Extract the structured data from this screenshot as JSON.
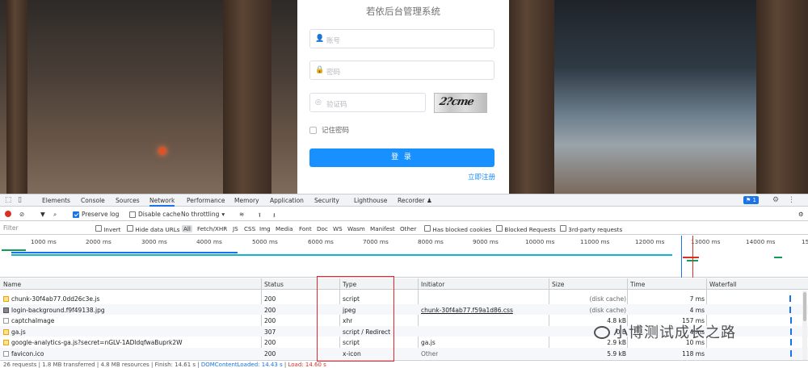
{
  "login": {
    "title": "若依后台管理系统",
    "username_placeholder": "账号",
    "password_placeholder": "密码",
    "code_placeholder": "验证码",
    "captcha_text": "2?cme",
    "remember": "记住密码",
    "submit": "登 录",
    "register": "立即注册"
  },
  "devtools": {
    "tabs": [
      "Elements",
      "Console",
      "Sources",
      "Network",
      "Performance",
      "Memory",
      "Application",
      "Security",
      "Lighthouse",
      "Recorder ♟"
    ],
    "active_tab": "Network",
    "issues_count": "1",
    "toolbar": {
      "preserve_log": "Preserve log",
      "disable_cache": "Disable cache",
      "throttling": "No throttling"
    },
    "filter": {
      "placeholder": "Filter",
      "invert": "Invert",
      "hide_data_urls": "Hide data URLs",
      "types": [
        "All",
        "Fetch/XHR",
        "JS",
        "CSS",
        "Img",
        "Media",
        "Font",
        "Doc",
        "WS",
        "Wasm",
        "Manifest",
        "Other"
      ],
      "blocked_cookies": "Has blocked cookies",
      "blocked_requests": "Blocked Requests",
      "third_party": "3rd-party requests"
    },
    "timeline_ticks": [
      "1000 ms",
      "2000 ms",
      "3000 ms",
      "4000 ms",
      "5000 ms",
      "6000 ms",
      "7000 ms",
      "8000 ms",
      "9000 ms",
      "10000 ms",
      "11000 ms",
      "12000 ms",
      "13000 ms",
      "14000 ms",
      "15"
    ],
    "columns": {
      "name": "Name",
      "status": "Status",
      "type": "Type",
      "initiator": "Initiator",
      "size": "Size",
      "time": "Time",
      "waterfall": "Waterfall"
    },
    "rows": [
      {
        "name": "chunk-30f4ab77.0dd26c3e.js",
        "status": "200",
        "type": "script",
        "initiator": "",
        "size": "(disk cache)",
        "time": "7 ms",
        "icon": "file-js-icon"
      },
      {
        "name": "login-background.f9f49138.jpg",
        "status": "200",
        "type": "jpeg",
        "initiator": "chunk-30f4ab77.f59a1d86.css",
        "size": "(disk cache)",
        "time": "4 ms",
        "icon": "file-image-icon"
      },
      {
        "name": "captchaImage",
        "status": "200",
        "type": "xhr",
        "initiator": "",
        "size": "4.8 kB",
        "time": "157 ms",
        "icon": "file-doc-icon"
      },
      {
        "name": "ga.js",
        "status": "307",
        "type": "script / Redirect",
        "initiator": "",
        "size": "0 B",
        "time": "4 ms",
        "icon": "file-js-icon"
      },
      {
        "name": "google-analytics-ga.js?secret=nGLV-1ADldqfwaBuprk2W",
        "status": "200",
        "type": "script",
        "initiator": "ga.js",
        "size": "2.9 kB",
        "time": "10 ms",
        "icon": "file-js-icon"
      },
      {
        "name": "favicon.ico",
        "status": "200",
        "type": "x-icon",
        "initiator": "Other",
        "size": "5.9 kB",
        "time": "118 ms",
        "icon": "file-doc-icon"
      }
    ],
    "status_bar": {
      "requests": "26 requests",
      "transferred": "1.8 MB transferred",
      "resources": "4.8 MB resources",
      "finish": "Finish: 14.61 s",
      "dom_loaded": "DOMContentLoaded: 14.43 s",
      "load": "Load: 14.60 s"
    }
  },
  "watermark": "小博测试成长之路"
}
